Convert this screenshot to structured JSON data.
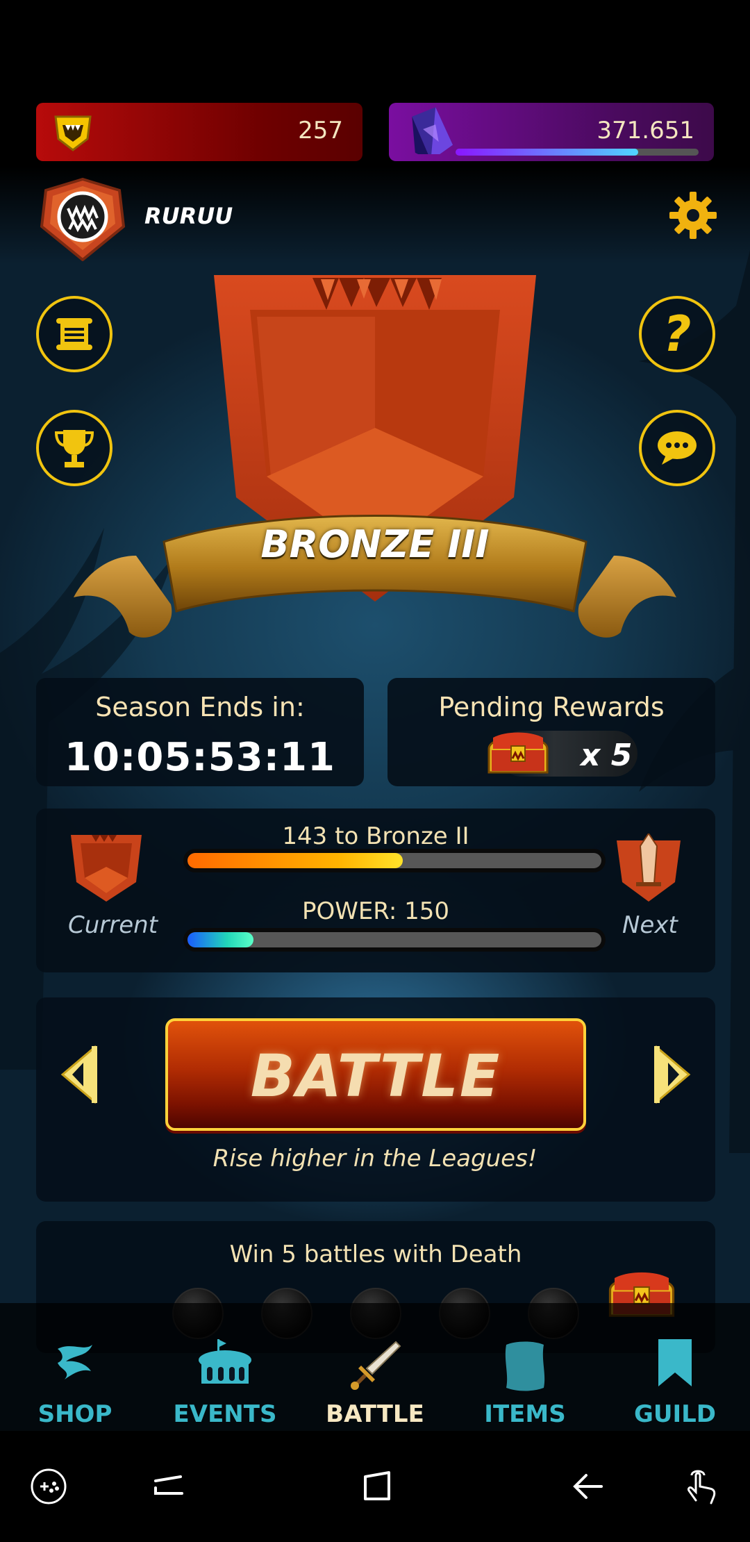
{
  "resources": {
    "dec_value": "257",
    "credits_value": "371.651",
    "xp_progress": 0.75
  },
  "player": {
    "name": "RURUU"
  },
  "league": {
    "title": "BRONZE III"
  },
  "season": {
    "label": "Season Ends in:",
    "value": "10:05:53:11"
  },
  "rewards": {
    "label": "Pending Rewards",
    "count": "x 5"
  },
  "progress": {
    "rating_label": "143 to Bronze II",
    "rating_progress": 0.52,
    "power_label": "POWER: 150",
    "power_progress": 0.16,
    "current_caption": "Current",
    "next_caption": "Next"
  },
  "battle": {
    "button_label": "BATTLE",
    "subtitle": "Rise higher in the Leagues!"
  },
  "quest": {
    "title": "Win 5 battles with Death",
    "completed": 0,
    "total": 5
  },
  "nav": {
    "items": [
      {
        "label": "SHOP",
        "icon": "shop-icon"
      },
      {
        "label": "EVENTS",
        "icon": "events-icon"
      },
      {
        "label": "BATTLE",
        "icon": "battle-sword-icon",
        "active": true
      },
      {
        "label": "ITEMS",
        "icon": "items-icon"
      },
      {
        "label": "GUILD",
        "icon": "guild-icon"
      }
    ]
  },
  "colors": {
    "accent_gold": "#f1c40f",
    "nav_teal": "#3ab8c9",
    "battle_orange": "#e0520b"
  }
}
